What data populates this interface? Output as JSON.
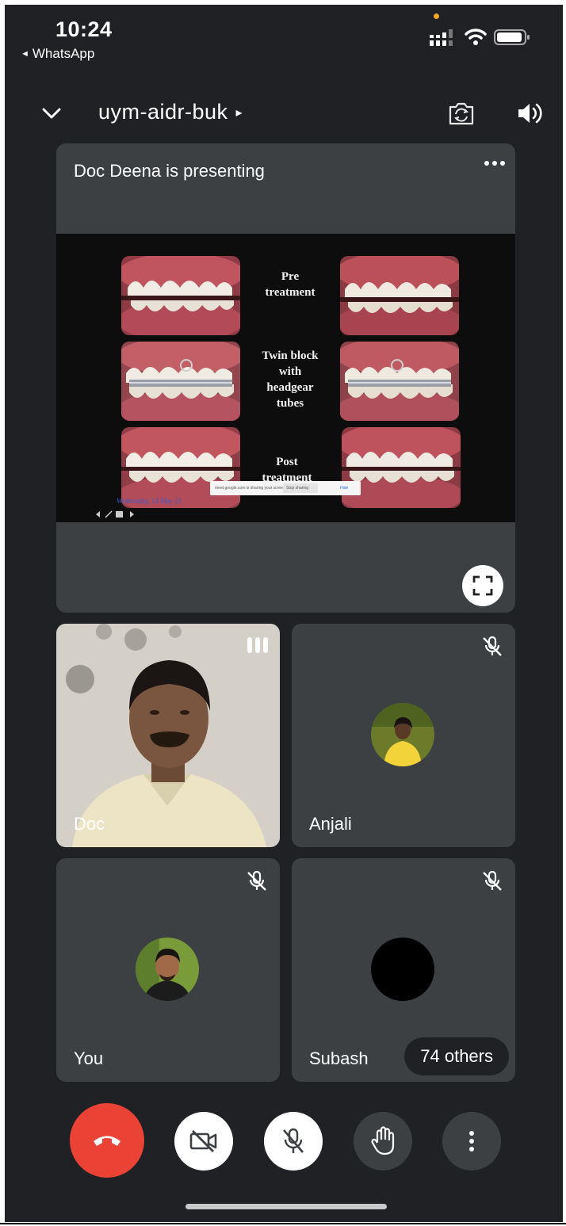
{
  "status_bar": {
    "time": "10:24",
    "back_app": "WhatsApp",
    "back_glyph": "◄"
  },
  "header": {
    "meeting_code": "uym-aidr-buk",
    "code_arrow": "▸"
  },
  "presentation": {
    "title": "Doc Deena is presenting",
    "slide": {
      "label_pre": [
        "Pre",
        "treatment"
      ],
      "label_twin": [
        "Twin block",
        "with",
        "headgear",
        "tubes"
      ],
      "label_post": [
        "Post",
        "treatment"
      ],
      "share_bar_text": "meet.google.com is sharing your screen.",
      "share_bar_stop": "Stop sharing",
      "share_bar_hide": "Hide",
      "date_text": "Wednesday, 14 May 21"
    }
  },
  "tiles": [
    {
      "name": "Doc",
      "state": "speaking"
    },
    {
      "name": "Anjali",
      "state": "muted"
    },
    {
      "name": "You",
      "state": "muted"
    },
    {
      "name": "Subash",
      "state": "muted"
    }
  ],
  "others_label": "74 others",
  "colors": {
    "background": "#202124",
    "tile": "#3c4043",
    "end_call": "#ea4335",
    "accent_status": "#f5a623"
  },
  "icons": {
    "hang_up": "phone-hangup-icon",
    "camera": "video-off-icon",
    "microphone": "mic-off-icon",
    "raise_hand": "hand-icon",
    "more": "more-vert-icon"
  }
}
